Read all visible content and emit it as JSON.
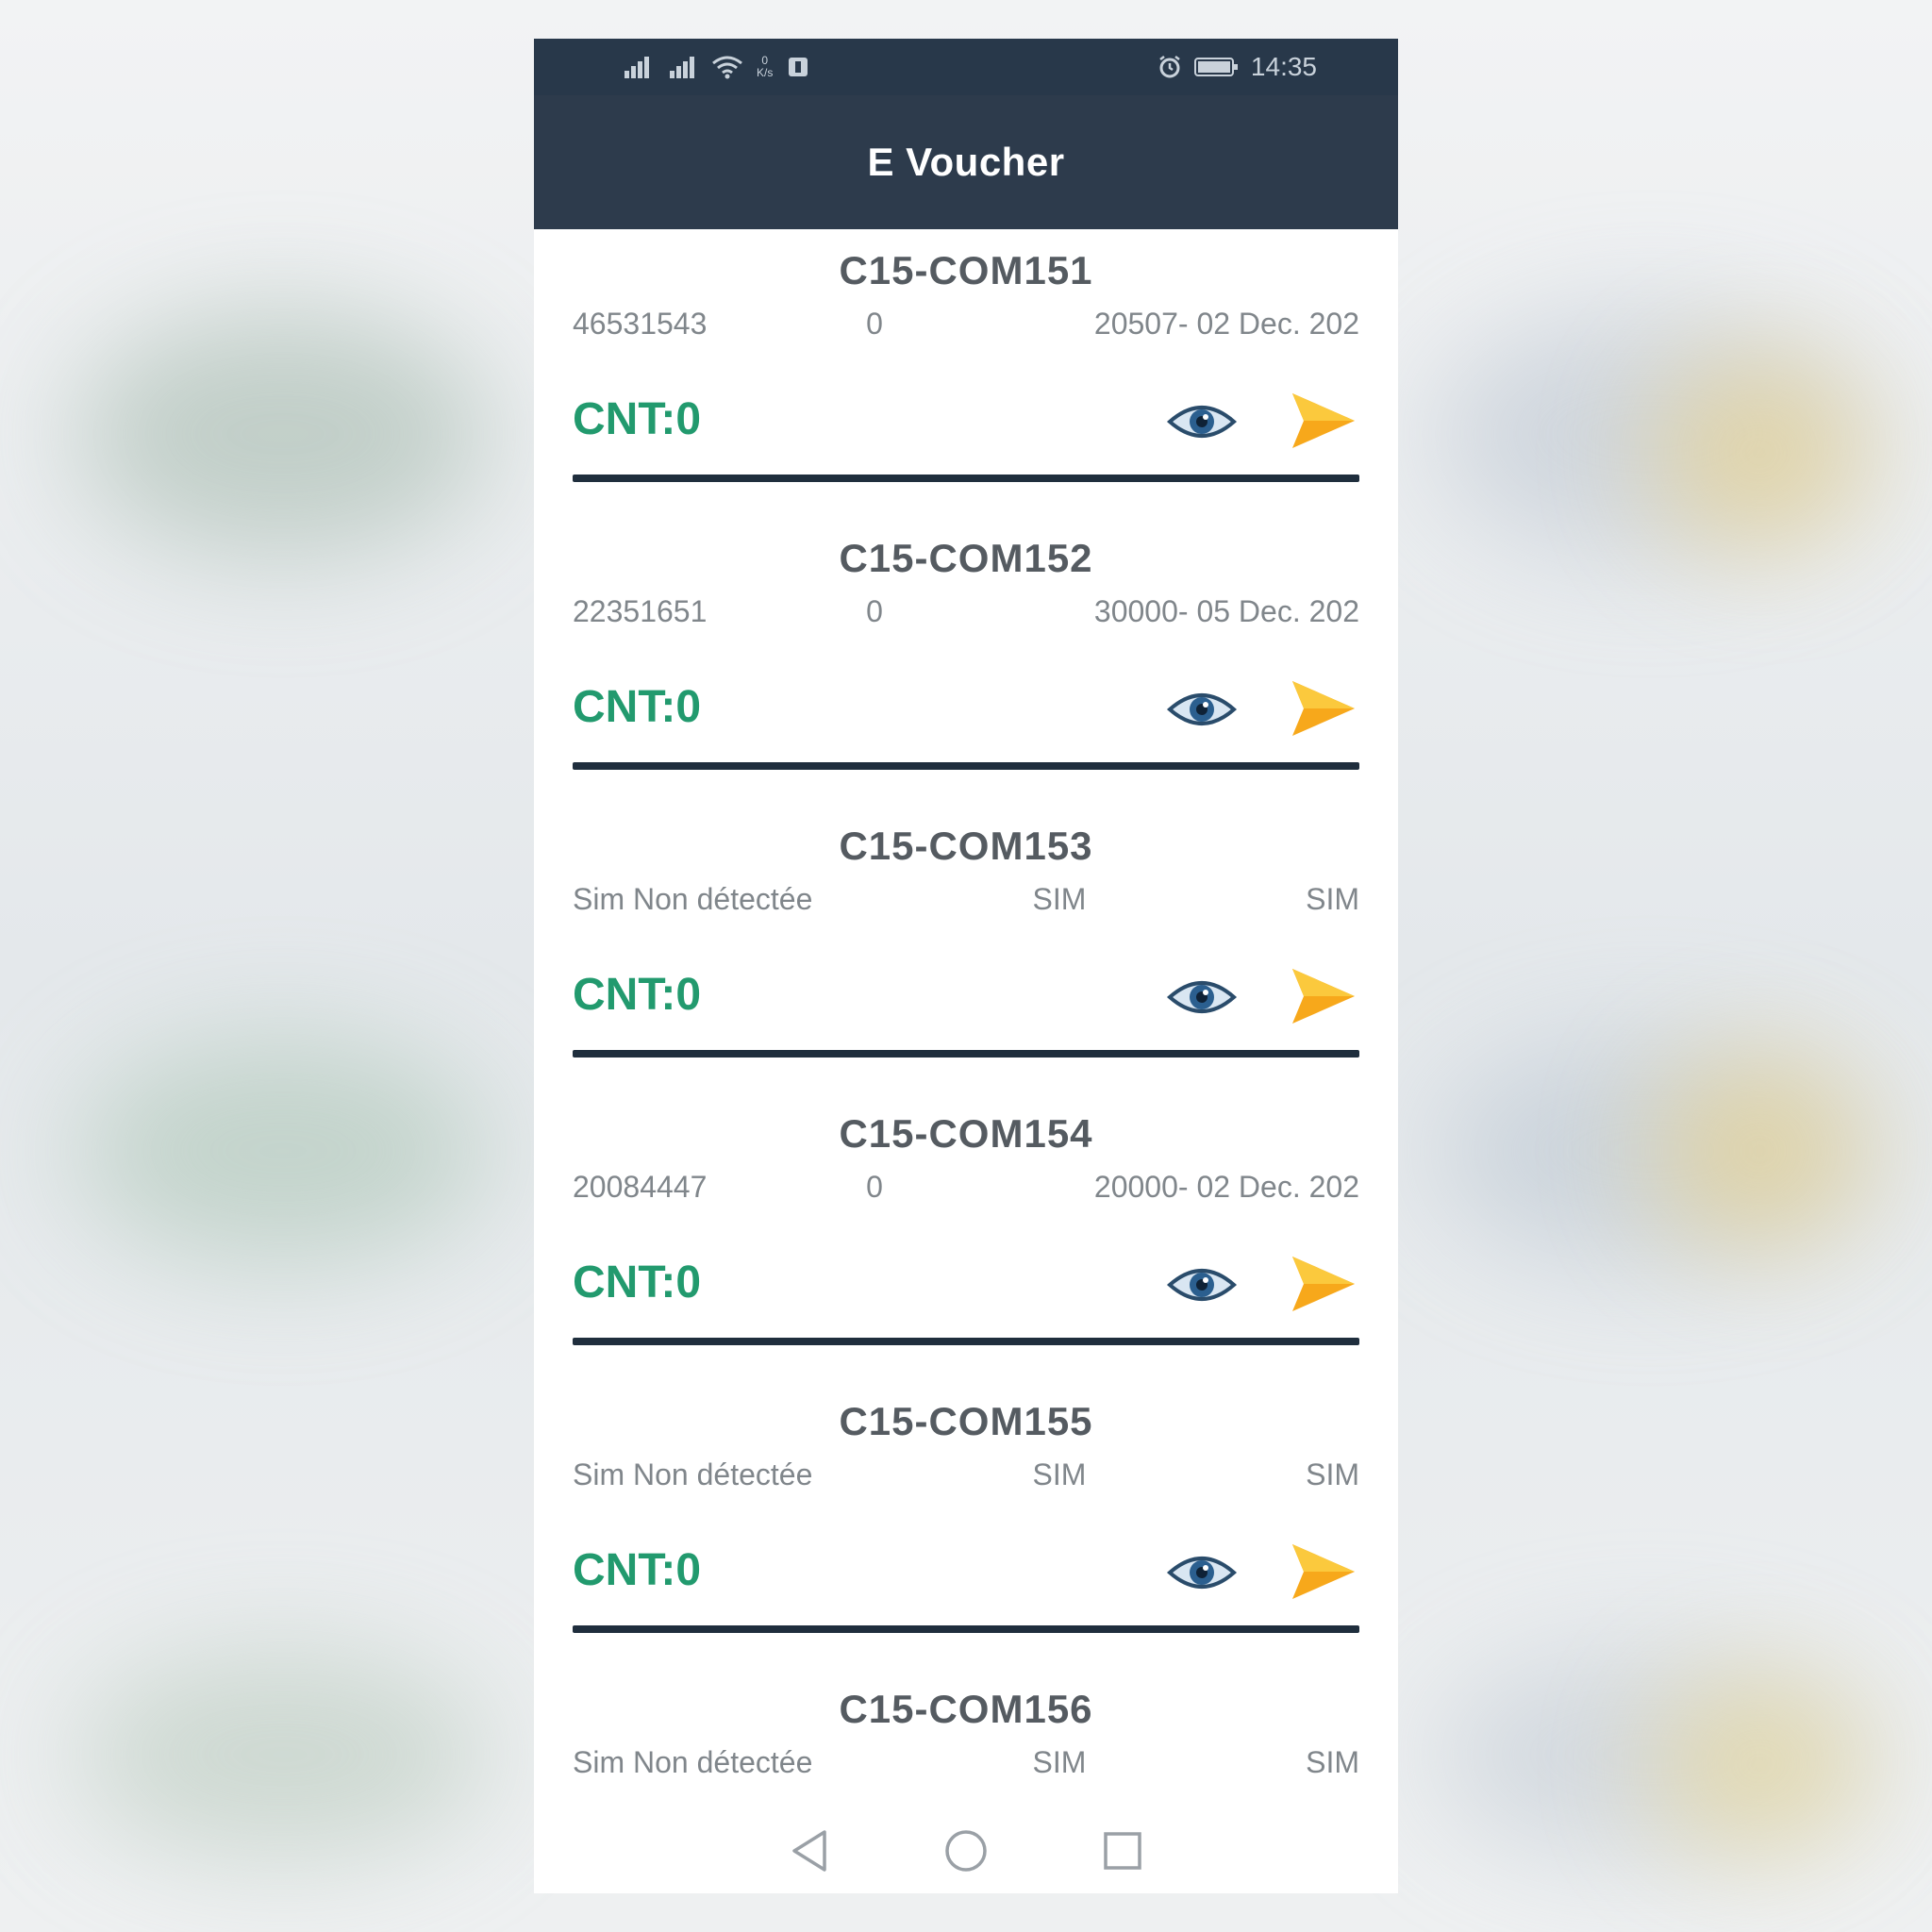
{
  "status_bar": {
    "left_icons": [
      "signal-1-icon",
      "signal-2-icon",
      "wifi-icon",
      "data-speed-icon",
      "app-notification-icon"
    ],
    "data_speed": "0",
    "data_unit": "K/s",
    "right_icons": [
      "alarm-icon",
      "battery-icon"
    ],
    "time": "14:35"
  },
  "app_bar": {
    "title": "E Voucher"
  },
  "vouchers": [
    {
      "title": "C15-COM151",
      "col1": "46531543",
      "col2": "0",
      "col3": "20507- 02 Dec. 202",
      "cnt": "CNT:0"
    },
    {
      "title": "C15-COM152",
      "col1": "22351651",
      "col2": "0",
      "col3": "30000- 05 Dec. 202",
      "cnt": "CNT:0"
    },
    {
      "title": "C15-COM153",
      "col1": "Sim Non détectée",
      "col2": "SIM",
      "col3": "SIM",
      "cnt": "CNT:0"
    },
    {
      "title": "C15-COM154",
      "col1": "20084447",
      "col2": "0",
      "col3": "20000- 02 Dec. 202",
      "cnt": "CNT:0"
    },
    {
      "title": "C15-COM155",
      "col1": "Sim Non détectée",
      "col2": "SIM",
      "col3": "SIM",
      "cnt": "CNT:0"
    },
    {
      "title": "C15-COM156",
      "col1": "Sim Non détectée",
      "col2": "SIM",
      "col3": "SIM"
    }
  ],
  "item_icons": {
    "view": "eye-icon",
    "send": "send-arrow-icon"
  },
  "nav_bar": {
    "icons": [
      "back-icon",
      "home-icon",
      "recents-icon"
    ]
  },
  "colors": {
    "app_bar": "#2d3b4c",
    "status_bar": "#28384a",
    "cnt_text": "#229a6e",
    "divider": "#1f2e3d",
    "send_arrow": "#f7a81b",
    "eye": "#2b5f8f"
  }
}
